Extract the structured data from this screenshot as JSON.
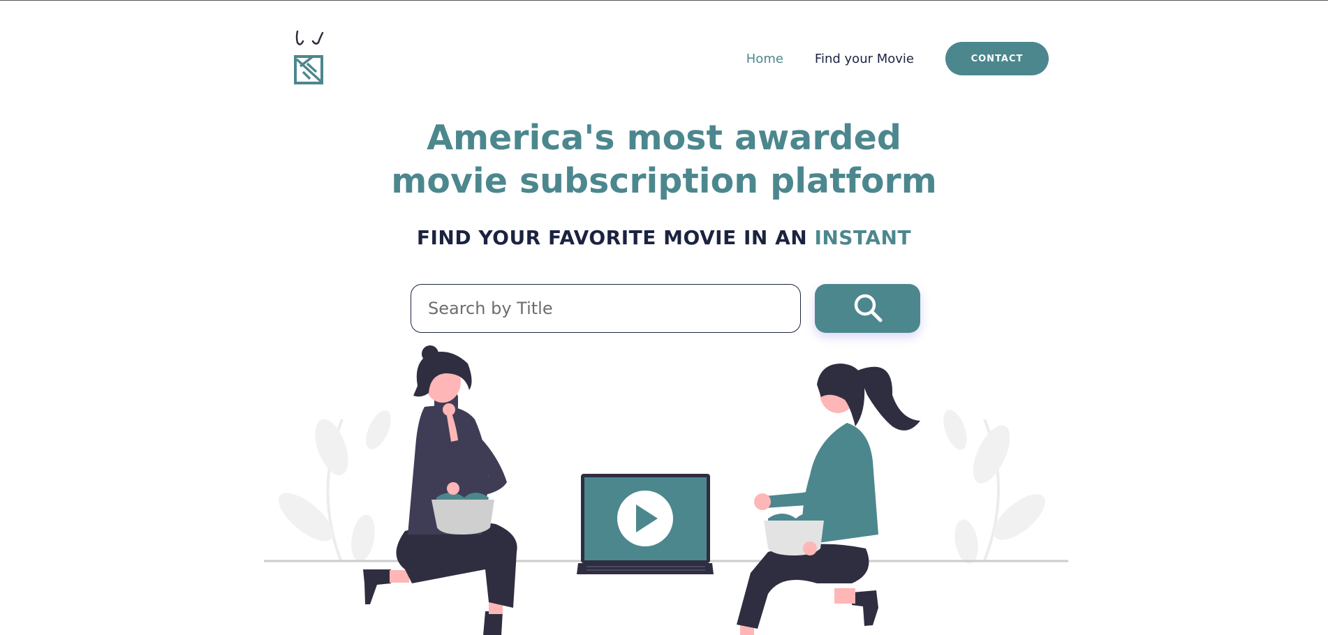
{
  "header": {
    "logo_icon": "brand-logo-icon",
    "nav": {
      "home_label": "Home",
      "find_label": "Find your Movie",
      "contact_label": "CONTACT"
    }
  },
  "hero": {
    "title_line1": "America's most awarded",
    "title_line2": "movie subscription platform",
    "subtitle_main": "FIND YOUR FAVORITE MOVIE IN AN",
    "subtitle_accent": "INSTANT"
  },
  "search": {
    "placeholder": "Search by Title",
    "value": "",
    "button_icon": "search-icon"
  },
  "colors": {
    "accent": "#4c878e",
    "navy": "#1b2340",
    "dark_clothing": "#3f3d56",
    "skin": "#ffb6b6"
  }
}
